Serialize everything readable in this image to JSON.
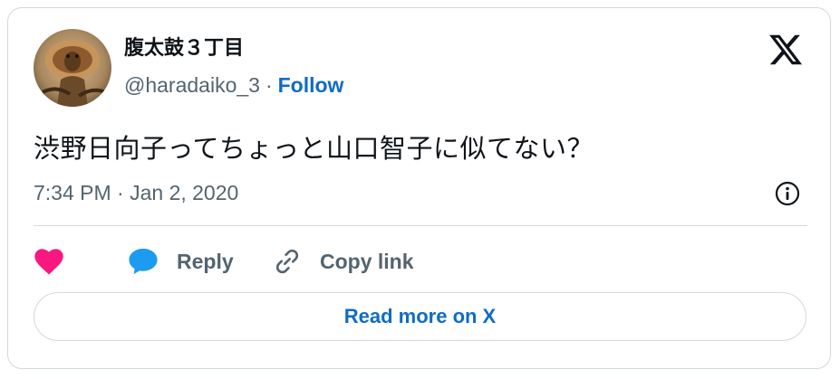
{
  "author": {
    "display_name": "腹太鼓３丁目",
    "handle": "@haradaiko_3",
    "separator": "·",
    "follow_label": "Follow"
  },
  "tweet": {
    "text": "渋野日向子ってちょっと山口智子に似てない？",
    "timestamp": "7:34 PM · Jan 2, 2020"
  },
  "actions": {
    "like_icon": "heart-icon",
    "reply_label": "Reply",
    "copy_link_label": "Copy link"
  },
  "footer": {
    "read_more_label": "Read more on X"
  },
  "colors": {
    "heart": "#f91880",
    "reply_bubble": "#1d9bf0",
    "link_blue": "#0f6cc5",
    "text_primary": "#0f1419",
    "text_secondary": "#536471",
    "border": "#cfd9de"
  }
}
